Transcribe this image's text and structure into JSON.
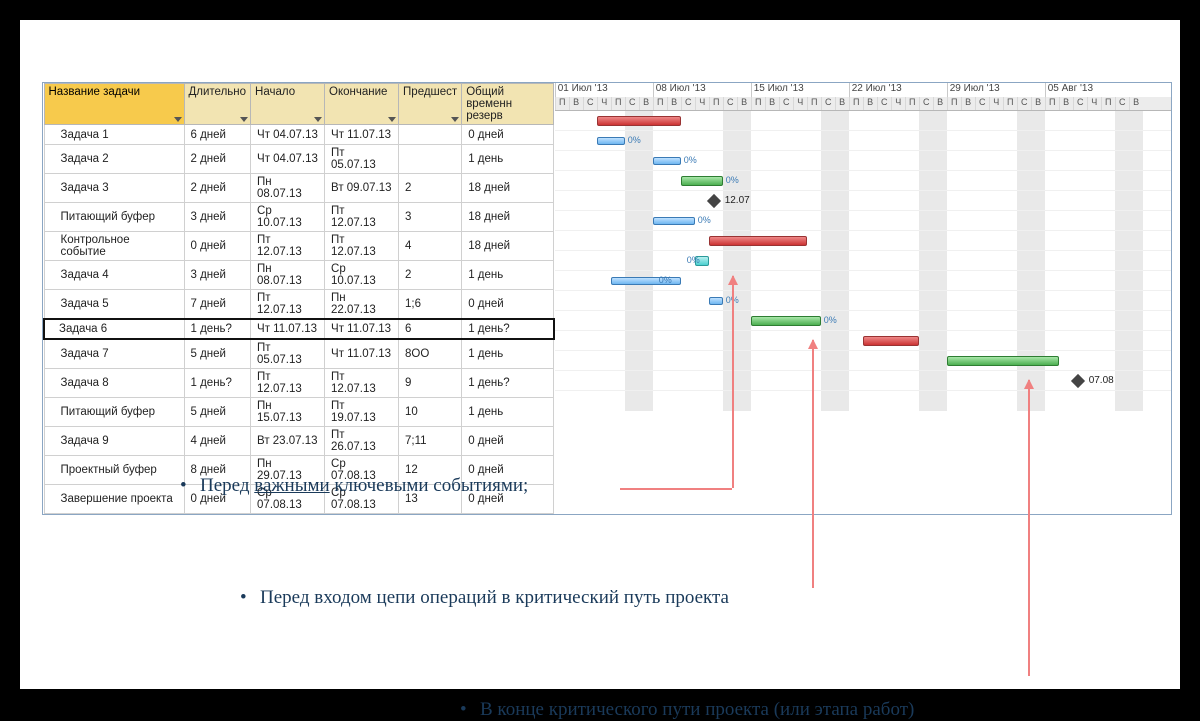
{
  "cols": {
    "name": "Название задачи",
    "dur": "Длительно",
    "start": "Начало",
    "end": "Окончание",
    "pred": "Предшест",
    "slack": "Общий временн\nрезерв"
  },
  "weeks": [
    "01 Июл '13",
    "08 Июл '13",
    "15 Июл '13",
    "22 Июл '13",
    "29 Июл '13",
    "05 Авг '13"
  ],
  "days": [
    "П",
    "В",
    "С",
    "Ч",
    "П",
    "С",
    "В"
  ],
  "rows": [
    {
      "name": "Задача 1",
      "dur": "6 дней",
      "start": "Чт 04.07.13",
      "end": "Чт 11.07.13",
      "pred": "",
      "slack": "0 дней"
    },
    {
      "name": "Задача 2",
      "dur": "2 дней",
      "start": "Чт 04.07.13",
      "end": "Пт 05.07.13",
      "pred": "",
      "slack": "1 день"
    },
    {
      "name": "Задача 3",
      "dur": "2 дней",
      "start": "Пн 08.07.13",
      "end": "Вт 09.07.13",
      "pred": "2",
      "slack": "18 дней"
    },
    {
      "name": "Питающий буфер",
      "dur": "3 дней",
      "start": "Ср 10.07.13",
      "end": "Пт 12.07.13",
      "pred": "3",
      "slack": "18 дней"
    },
    {
      "name": "Контрольное событие",
      "dur": "0 дней",
      "start": "Пт 12.07.13",
      "end": "Пт 12.07.13",
      "pred": "4",
      "slack": "18 дней"
    },
    {
      "name": "Задача 4",
      "dur": "3 дней",
      "start": "Пн 08.07.13",
      "end": "Ср 10.07.13",
      "pred": "2",
      "slack": "1 день"
    },
    {
      "name": "Задача 5",
      "dur": "7 дней",
      "start": "Пт 12.07.13",
      "end": "Пн 22.07.13",
      "pred": "1;6",
      "slack": "0 дней"
    },
    {
      "name": "Задача 6",
      "dur": "1 день?",
      "start": "Чт 11.07.13",
      "end": "Чт 11.07.13",
      "pred": "6",
      "slack": "1 день?",
      "sel": true
    },
    {
      "name": "Задача 7",
      "dur": "5 дней",
      "start": "Пт 05.07.13",
      "end": "Чт 11.07.13",
      "pred": "8ОО",
      "slack": "1 день"
    },
    {
      "name": "Задача 8",
      "dur": "1 день?",
      "start": "Пт 12.07.13",
      "end": "Пт 12.07.13",
      "pred": "9",
      "slack": "1 день?"
    },
    {
      "name": "Питающий буфер",
      "dur": "5 дней",
      "start": "Пн 15.07.13",
      "end": "Пт 19.07.13",
      "pred": "10",
      "slack": "1 день"
    },
    {
      "name": "Задача 9",
      "dur": "4 дней",
      "start": "Вт 23.07.13",
      "end": "Пт 26.07.13",
      "pred": "7;11",
      "slack": "0 дней"
    },
    {
      "name": "Проектный буфер",
      "dur": "8 дней",
      "start": "Пн 29.07.13",
      "end": "Ср 07.08.13",
      "pred": "12",
      "slack": "0 дней"
    },
    {
      "name": "Завершение проекта",
      "dur": "0 дней",
      "start": "Ср 07.08.13",
      "end": "Ср 07.08.13",
      "pred": "13",
      "slack": "0 дней"
    }
  ],
  "milestones": {
    "m1": "12.07",
    "m2": "07.08"
  },
  "pct": "0%",
  "bullets": {
    "b1a": "Перед ",
    "b1b": "важными",
    "b1c": " ключевыми событиями;",
    "b2": "Перед входом цепи операций в критический путь проекта",
    "b3": "В конце критического пути проекта (или этапа работ)"
  }
}
